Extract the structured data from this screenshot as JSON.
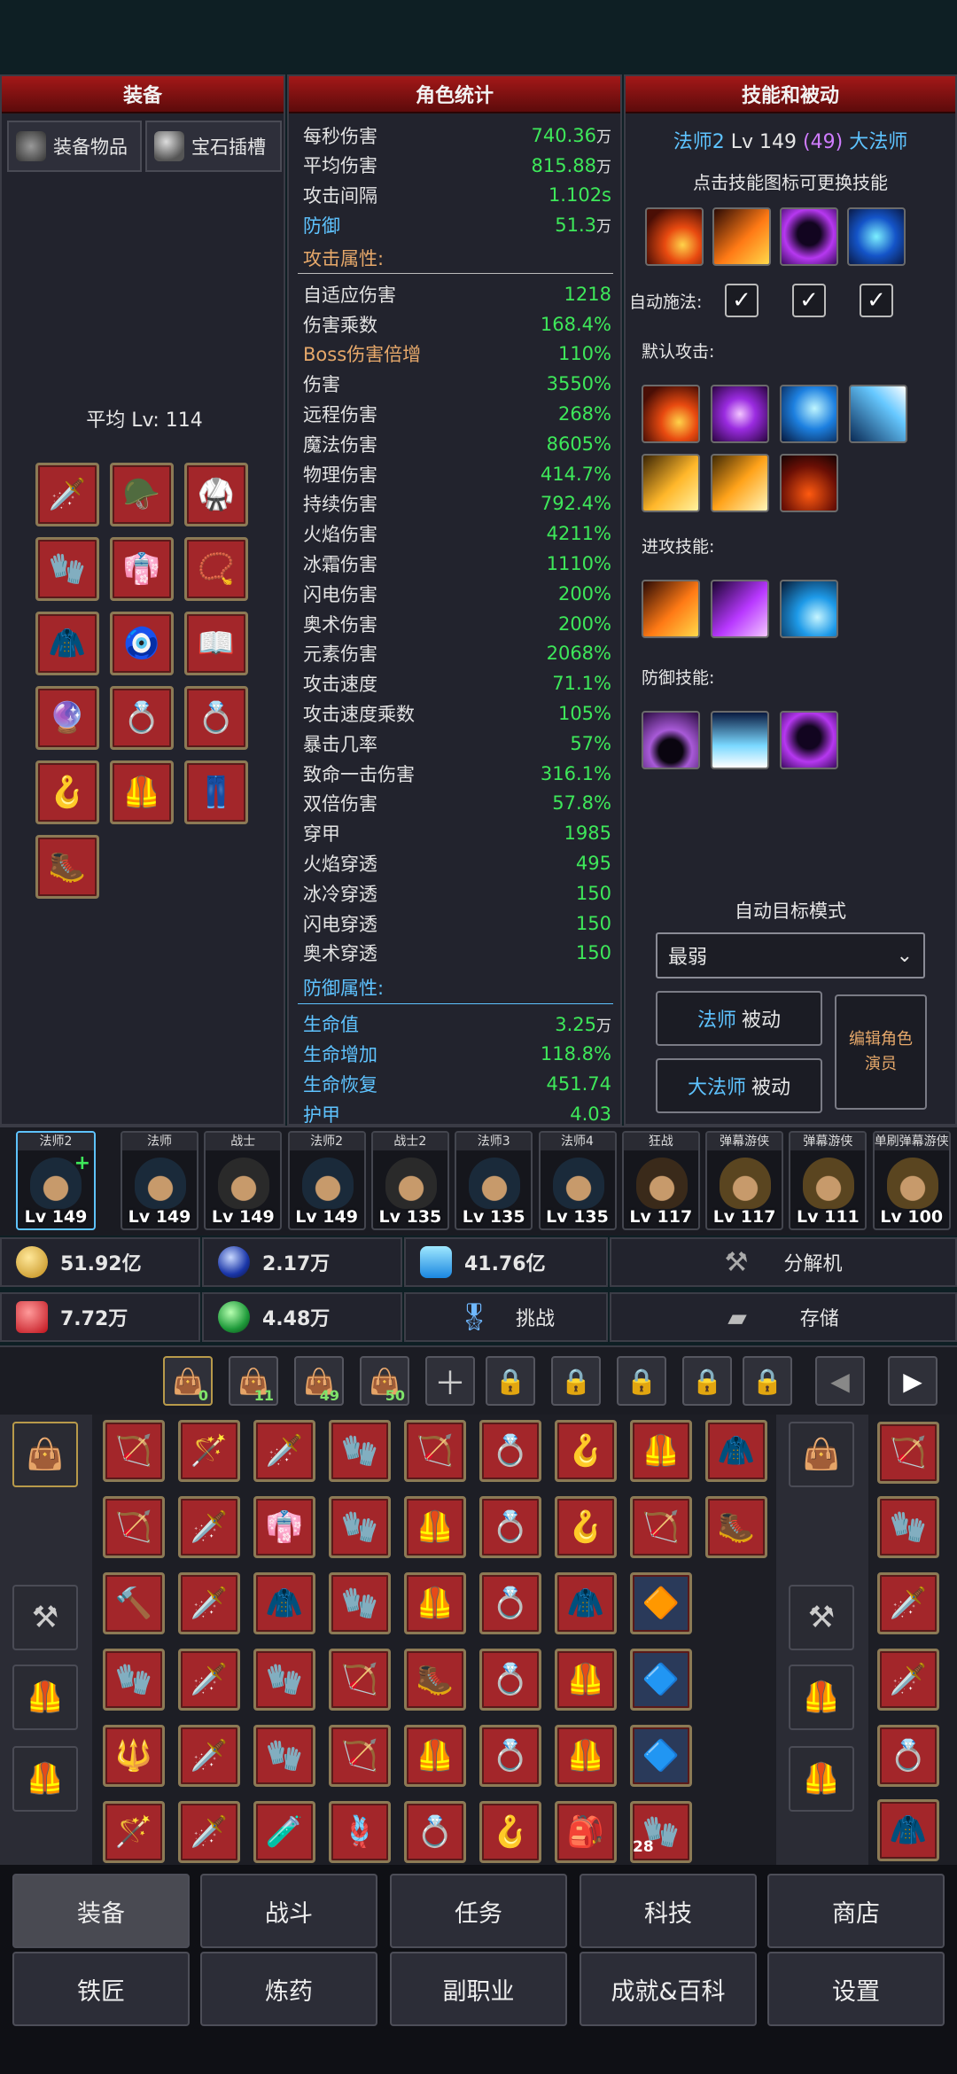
{
  "equip_panel": {
    "title": "装备",
    "tab_items": "装备物品",
    "tab_gems": "宝石插槽",
    "avg_level": "平均 Lv: 114",
    "slots": [
      "🗡️",
      "🪖",
      "🥋",
      "🧤",
      "👘",
      "📿",
      "🧥",
      "🧿",
      "📖",
      "🔮",
      "💍",
      "💍",
      "🪝",
      "🦺",
      "👖",
      "🥾"
    ]
  },
  "stats_panel": {
    "title": "角色统计",
    "top": [
      {
        "label": "每秒伤害",
        "value": "740.36",
        "unit": "万"
      },
      {
        "label": "平均伤害",
        "value": "815.88",
        "unit": "万"
      },
      {
        "label": "攻击间隔",
        "value": "1.102s",
        "unit": ""
      },
      {
        "label": "防御",
        "value": "51.3",
        "unit": "万",
        "blue": true
      }
    ],
    "attack_header": "攻击属性:",
    "attack": [
      {
        "label": "自适应伤害",
        "value": "1218"
      },
      {
        "label": "伤害乘数",
        "value": "168.4%"
      },
      {
        "label": "Boss伤害倍增",
        "value": "110%"
      },
      {
        "label": "伤害",
        "value": "3550%"
      },
      {
        "label": "远程伤害",
        "value": "268%"
      },
      {
        "label": "魔法伤害",
        "value": "8605%"
      },
      {
        "label": "物理伤害",
        "value": "414.7%"
      },
      {
        "label": "持续伤害",
        "value": "792.4%"
      },
      {
        "label": "火焰伤害",
        "value": "4211%"
      },
      {
        "label": "冰霜伤害",
        "value": "1110%"
      },
      {
        "label": "闪电伤害",
        "value": "200%"
      },
      {
        "label": "奥术伤害",
        "value": "200%"
      },
      {
        "label": "元素伤害",
        "value": "2068%"
      },
      {
        "label": "攻击速度",
        "value": "71.1%"
      },
      {
        "label": "攻击速度乘数",
        "value": "105%"
      },
      {
        "label": "暴击几率",
        "value": "57%"
      },
      {
        "label": "致命一击伤害",
        "value": "316.1%"
      },
      {
        "label": "双倍伤害",
        "value": "57.8%"
      },
      {
        "label": "穿甲",
        "value": "1985"
      },
      {
        "label": "火焰穿透",
        "value": "495"
      },
      {
        "label": "冰冷穿透",
        "value": "150"
      },
      {
        "label": "闪电穿透",
        "value": "150"
      },
      {
        "label": "奥术穿透",
        "value": "150"
      }
    ],
    "defense_header": "防御属性:",
    "defense": [
      {
        "label": "生命值",
        "value": "3.25",
        "unit": "万"
      },
      {
        "label": "生命增加",
        "value": "118.8%",
        "unit": ""
      },
      {
        "label": "生命恢复",
        "value": "451.74",
        "unit": ""
      },
      {
        "label": "护甲",
        "value": "4.03",
        "unit": ""
      }
    ]
  },
  "skills_panel": {
    "title": "技能和被动",
    "class_a": "法师2",
    "level": "Lv 149",
    "points": "(49)",
    "class_b": "大法师",
    "hint": "点击技能图标可更换技能",
    "auto_cast_label": "自动施法:",
    "default_attack_label": "默认攻击:",
    "offense_label": "进攻技能:",
    "defense_label": "防御技能:",
    "targeting_label": "自动目标模式",
    "targeting_value": "最弱",
    "mage_passive": {
      "cls": "法师",
      "txt": "被动"
    },
    "archmage_passive": {
      "cls": "大法师",
      "txt": "被动"
    },
    "edit_role": "编辑角色演员"
  },
  "heroes": [
    {
      "name": "法师2",
      "lv": "Lv 149"
    },
    {
      "name": "法师",
      "lv": "Lv 149"
    },
    {
      "name": "战士",
      "lv": "Lv 149"
    },
    {
      "name": "法师2",
      "lv": "Lv 149"
    },
    {
      "name": "战士2",
      "lv": "Lv 135"
    },
    {
      "name": "法师3",
      "lv": "Lv 135"
    },
    {
      "name": "法师4",
      "lv": "Lv 135"
    },
    {
      "name": "狂战",
      "lv": "Lv 117"
    },
    {
      "name": "弹幕游侠",
      "lv": "Lv 117"
    },
    {
      "name": "弹幕游侠",
      "lv": "Lv 111"
    },
    {
      "name": "单刷弹幕游侠",
      "lv": "Lv 100"
    }
  ],
  "resources": {
    "gold": "51.92亿",
    "orb": "2.17万",
    "crystal": "41.76亿",
    "ruby": "7.72万",
    "leaf": "4.48万",
    "dismantler": "分解机",
    "challenge": "挑战",
    "storage": "存储"
  },
  "bag_tabs": [
    "0",
    "11",
    "49",
    "50"
  ],
  "inventory_badge": "28",
  "nav": [
    "装备",
    "战斗",
    "任务",
    "科技",
    "商店",
    "铁匠",
    "炼药",
    "副职业",
    "成就&百科",
    "设置"
  ],
  "colors": {
    "accent_green": "#3ee85a",
    "accent_blue": "#5ec3ff",
    "header_red": "#a31818"
  }
}
